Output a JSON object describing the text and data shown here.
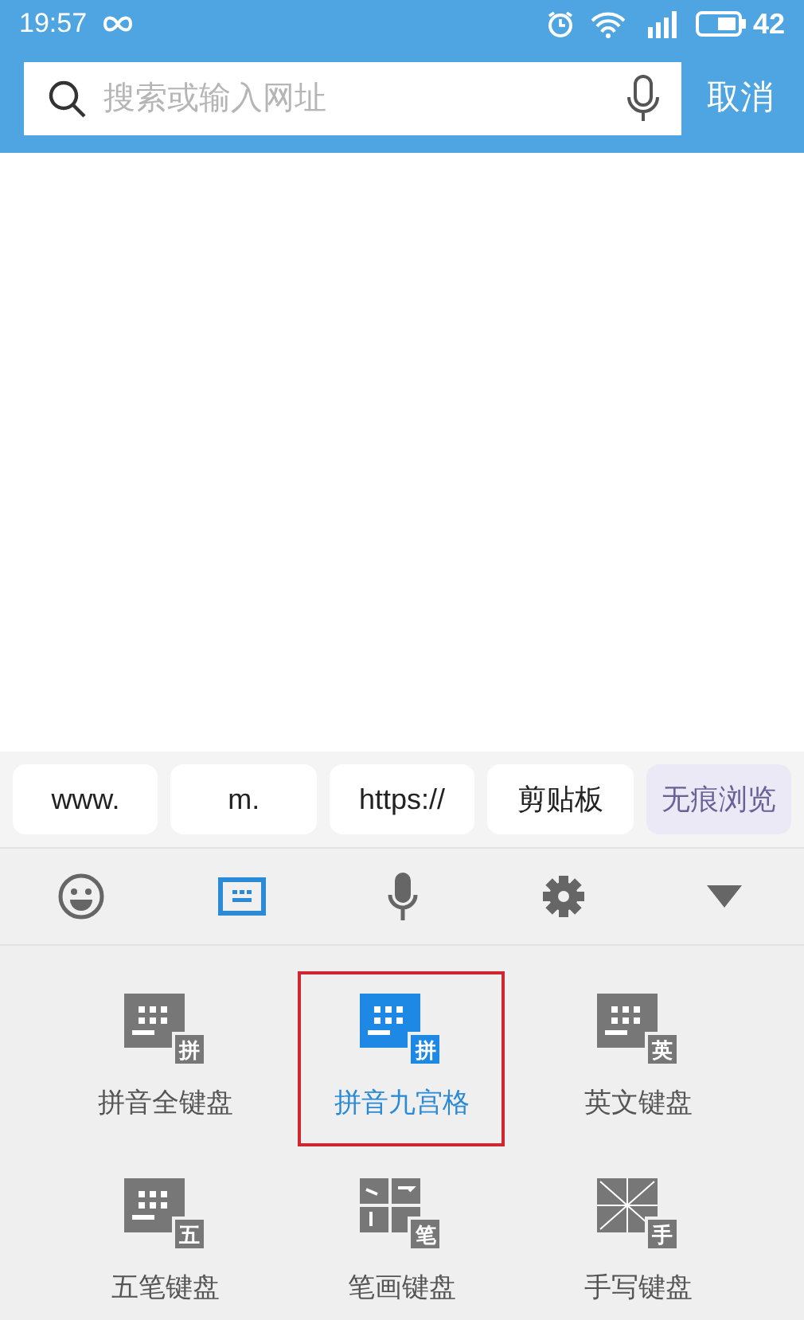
{
  "status_bar": {
    "time": "19:57",
    "battery": "42"
  },
  "search": {
    "placeholder": "搜索或输入网址",
    "cancel": "取消"
  },
  "shortcuts": [
    {
      "label": "www.",
      "kind": "plain"
    },
    {
      "label": "m.",
      "kind": "plain"
    },
    {
      "label": "https://",
      "kind": "plain"
    },
    {
      "label": "剪贴板",
      "kind": "plain"
    },
    {
      "label": "无痕浏览",
      "kind": "accent"
    }
  ],
  "toolbar": [
    {
      "kind": "emoji",
      "selected": false
    },
    {
      "kind": "keyboard",
      "selected": true
    },
    {
      "kind": "mic",
      "selected": false
    },
    {
      "kind": "settings",
      "selected": false
    },
    {
      "kind": "collapse",
      "selected": false
    }
  ],
  "keyboards": [
    {
      "label": "拼音全键盘",
      "badge": "拼",
      "kind": "grid",
      "selected": false,
      "outlined": false
    },
    {
      "label": "拼音九宫格",
      "badge": "拼",
      "kind": "grid",
      "selected": true,
      "outlined": true
    },
    {
      "label": "英文键盘",
      "badge": "英",
      "kind": "grid",
      "selected": false,
      "outlined": false
    },
    {
      "label": "五笔键盘",
      "badge": "五",
      "kind": "grid",
      "selected": false,
      "outlined": false
    },
    {
      "label": "笔画键盘",
      "badge": "笔",
      "kind": "strokes",
      "selected": false,
      "outlined": false
    },
    {
      "label": "手写键盘",
      "badge": "手",
      "kind": "handwriting",
      "selected": false,
      "outlined": false
    }
  ]
}
